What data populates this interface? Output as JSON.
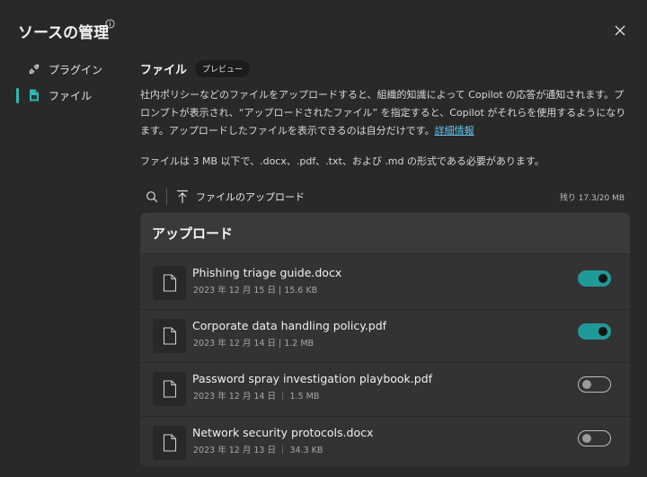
{
  "header": {
    "title": "ソースの管理"
  },
  "nav": {
    "items": [
      {
        "label": "プラグイン",
        "icon": "plug-icon"
      },
      {
        "label": "ファイル",
        "icon": "file-icon",
        "active": true
      }
    ]
  },
  "files_section": {
    "title": "ファイル",
    "badge": "プレビュー",
    "description": "社内ポリシーなどのファイルをアップロードすると、組織的知識によって Copilot の応答が通知されます。プロンプトが表示され、“アップロードされたファイル” を指定すると、Copilot がそれらを使用するようになります。アップロードしたファイルを表示できるのは自分だけです。",
    "learn_more": "詳細情報",
    "limit_note": "ファイルは 3 MB 以下で、.docx、.pdf、.txt、および .md の形式である必要があります。"
  },
  "toolbar": {
    "upload_label": "ファイルのアップロード",
    "remaining": "残り 17.3/20 MB"
  },
  "uploads": {
    "title": "アップロード",
    "files": [
      {
        "name": "Phishing triage guide.docx",
        "meta": "2023 年 12 月 15 日 | 15.6 KB",
        "enabled": true
      },
      {
        "name": "Corporate data handling policy.pdf",
        "meta": "2023 年 12 月 14 日 | 1.2 MB",
        "enabled": true
      },
      {
        "name": "Password spray investigation playbook.pdf",
        "meta": "2023 年 12 月 14 日 ｜ 1.5 MB",
        "enabled": false
      },
      {
        "name": "Network security protocols.docx",
        "meta": "2023 年 12 月 13 日 ｜ 34.3 KB",
        "enabled": false
      }
    ]
  },
  "colors": {
    "accent": "#1f9a98",
    "link": "#5fc7f0",
    "background": "#292929"
  }
}
